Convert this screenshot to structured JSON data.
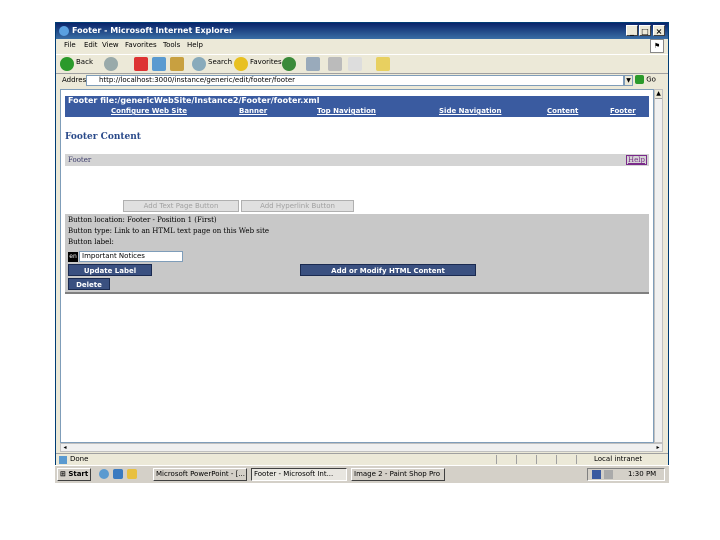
{
  "window": {
    "title": "Footer - Microsoft Internet Explorer"
  },
  "menu": [
    "File",
    "Edit",
    "View",
    "Favorites",
    "Tools",
    "Help"
  ],
  "toolbar": {
    "back": "Back",
    "search": "Search",
    "favorites": "Favorites"
  },
  "address": {
    "label": "Address",
    "url": "http://localhost:3000/instance/generic/edit/footer/footer",
    "go": "Go"
  },
  "page": {
    "file_header": "Footer file:/genericWebSite/Instance2/Footer/footer.xml",
    "nav": [
      "Configure Web Site",
      "Banner",
      "Top Navigation",
      "Side Navigation",
      "Content",
      "Footer"
    ],
    "section_title": "Footer Content",
    "panel_label": "Footer",
    "help": "Help",
    "add_text_button": "Add Text Page Button",
    "add_hyperlink_button": "Add Hyperlink Button",
    "button_location": "Button location: Footer - Position 1 (First)",
    "button_type": "Button type: Link to an HTML text page on this Web site",
    "button_label_caption": "Button label:",
    "lang_badge": "en",
    "label_value": "Important Notices",
    "update_label_button": "Update Label",
    "modify_html_button": "Add or Modify HTML Content",
    "delete_button": "Delete"
  },
  "status": {
    "left": "Done",
    "zone": "Local intranet"
  },
  "taskbar": {
    "start": "Start",
    "tasks": [
      "Microsoft PowerPoint - [...",
      "Footer - Microsoft Int...",
      "Image 2 - Paint Shop Pro"
    ],
    "clock": "1:30 PM"
  }
}
